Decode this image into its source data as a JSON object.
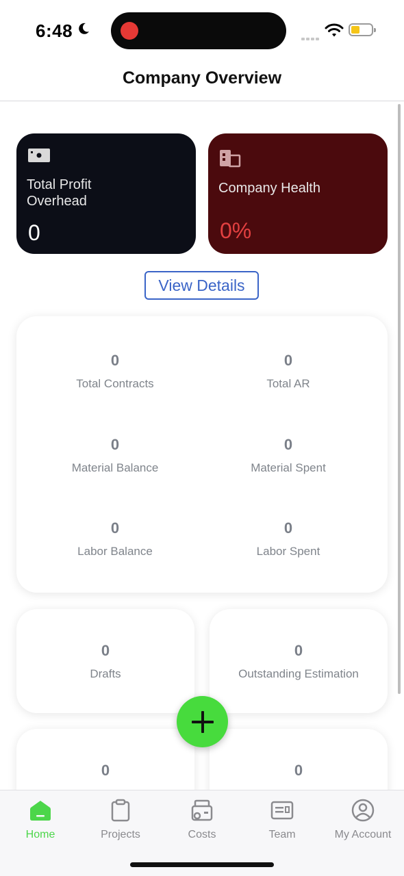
{
  "status_bar": {
    "time": "6:48",
    "battery_color": "#f5c518",
    "recording_color": "#e53935"
  },
  "header": {
    "title": "Company Overview"
  },
  "summary_cards": {
    "profit": {
      "label": "Total Profit Overhead",
      "value": "0",
      "icon": "cash-icon",
      "bg": "#0c0e17"
    },
    "health": {
      "label": "Company Health",
      "value": "0%",
      "icon": "building-icon",
      "bg": "#4b0a0d",
      "value_color": "#e34040"
    }
  },
  "view_details_label": "View Details",
  "stats": [
    {
      "value": "0",
      "label": "Total Contracts"
    },
    {
      "value": "0",
      "label": "Total AR"
    },
    {
      "value": "0",
      "label": "Material Balance"
    },
    {
      "value": "0",
      "label": "Material Spent"
    },
    {
      "value": "0",
      "label": "Labor Balance"
    },
    {
      "value": "0",
      "label": "Labor Spent"
    }
  ],
  "small_cards": [
    {
      "value": "0",
      "label": "Drafts"
    },
    {
      "value": "0",
      "label": "Outstanding Estimation"
    },
    {
      "value": "0",
      "label": ""
    },
    {
      "value": "0",
      "label": ""
    }
  ],
  "fab": {
    "icon": "plus-icon",
    "color": "#47db3d"
  },
  "tabs": [
    {
      "label": "Home",
      "icon": "home-icon",
      "active": true
    },
    {
      "label": "Projects",
      "icon": "clipboard-icon",
      "active": false
    },
    {
      "label": "Costs",
      "icon": "wallet-icon",
      "active": false
    },
    {
      "label": "Team",
      "icon": "id-card-icon",
      "active": false
    },
    {
      "label": "My Account",
      "icon": "user-circle-icon",
      "active": false
    }
  ],
  "accent_color": "#4cd64a"
}
